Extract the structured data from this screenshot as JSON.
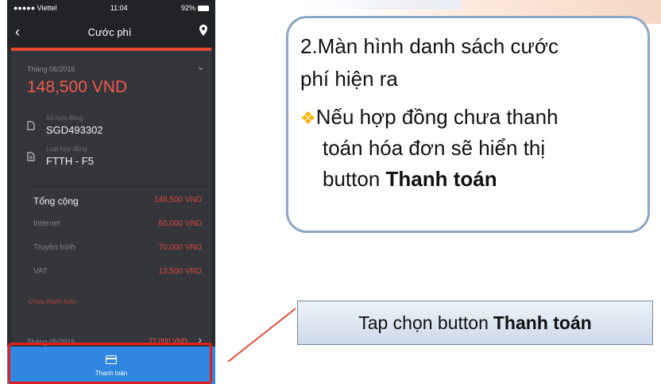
{
  "status_bar": {
    "carrier": "●●●●● Viettel",
    "time": "11:04",
    "battery": "92%"
  },
  "nav": {
    "title": "Cước phí"
  },
  "bill": {
    "month": "Tháng 06/2016",
    "amount": "148,500 VND",
    "contract_label": "Số hợp đồng",
    "contract_value": "SGD493302",
    "type_label": "Loại hợp đồng",
    "type_value": "FTTH - F5",
    "rows": [
      {
        "k": "Tổng cộng",
        "v": "148,500 VND"
      },
      {
        "k": "Internet",
        "v": "65,000 VND"
      },
      {
        "k": "Truyền hình",
        "v": "70,000 VND"
      },
      {
        "k": "VAT",
        "v": "13,500 VND"
      }
    ],
    "status": "Chưa thanh toán"
  },
  "bill2": {
    "month": "Tháng 05/2016",
    "amount": "77,000 VND"
  },
  "pay_button": {
    "label": "Thanh toán"
  },
  "callout": {
    "line1": "2.Màn hình danh sách cước",
    "line2": "phí hiện ra",
    "line3": "Nếu hợp đồng chưa thanh",
    "line4": "toán hóa đơn sẽ hiển thị",
    "line5_prefix": "button",
    "line5_bold": "Thanh toán"
  },
  "tap_note": {
    "prefix": "Tap chọn button",
    "bold": "Thanh toán"
  },
  "colors": {
    "accent": "#e64a35",
    "pay": "#2f87e2",
    "highlight": "#e02020"
  }
}
